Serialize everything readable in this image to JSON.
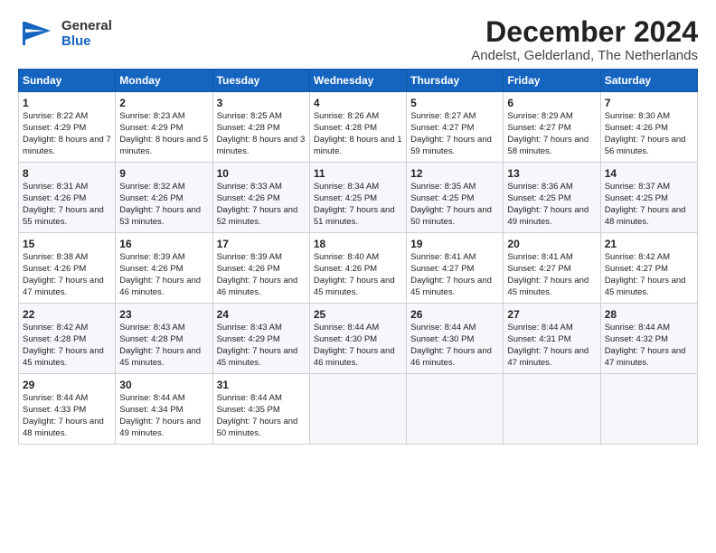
{
  "header": {
    "logo_general": "General",
    "logo_blue": "Blue",
    "title": "December 2024",
    "subtitle": "Andelst, Gelderland, The Netherlands"
  },
  "columns": [
    "Sunday",
    "Monday",
    "Tuesday",
    "Wednesday",
    "Thursday",
    "Friday",
    "Saturday"
  ],
  "weeks": [
    [
      {
        "day": "1",
        "sunrise": "Sunrise: 8:22 AM",
        "sunset": "Sunset: 4:29 PM",
        "daylight": "Daylight: 8 hours and 7 minutes."
      },
      {
        "day": "2",
        "sunrise": "Sunrise: 8:23 AM",
        "sunset": "Sunset: 4:29 PM",
        "daylight": "Daylight: 8 hours and 5 minutes."
      },
      {
        "day": "3",
        "sunrise": "Sunrise: 8:25 AM",
        "sunset": "Sunset: 4:28 PM",
        "daylight": "Daylight: 8 hours and 3 minutes."
      },
      {
        "day": "4",
        "sunrise": "Sunrise: 8:26 AM",
        "sunset": "Sunset: 4:28 PM",
        "daylight": "Daylight: 8 hours and 1 minute."
      },
      {
        "day": "5",
        "sunrise": "Sunrise: 8:27 AM",
        "sunset": "Sunset: 4:27 PM",
        "daylight": "Daylight: 7 hours and 59 minutes."
      },
      {
        "day": "6",
        "sunrise": "Sunrise: 8:29 AM",
        "sunset": "Sunset: 4:27 PM",
        "daylight": "Daylight: 7 hours and 58 minutes."
      },
      {
        "day": "7",
        "sunrise": "Sunrise: 8:30 AM",
        "sunset": "Sunset: 4:26 PM",
        "daylight": "Daylight: 7 hours and 56 minutes."
      }
    ],
    [
      {
        "day": "8",
        "sunrise": "Sunrise: 8:31 AM",
        "sunset": "Sunset: 4:26 PM",
        "daylight": "Daylight: 7 hours and 55 minutes."
      },
      {
        "day": "9",
        "sunrise": "Sunrise: 8:32 AM",
        "sunset": "Sunset: 4:26 PM",
        "daylight": "Daylight: 7 hours and 53 minutes."
      },
      {
        "day": "10",
        "sunrise": "Sunrise: 8:33 AM",
        "sunset": "Sunset: 4:26 PM",
        "daylight": "Daylight: 7 hours and 52 minutes."
      },
      {
        "day": "11",
        "sunrise": "Sunrise: 8:34 AM",
        "sunset": "Sunset: 4:25 PM",
        "daylight": "Daylight: 7 hours and 51 minutes."
      },
      {
        "day": "12",
        "sunrise": "Sunrise: 8:35 AM",
        "sunset": "Sunset: 4:25 PM",
        "daylight": "Daylight: 7 hours and 50 minutes."
      },
      {
        "day": "13",
        "sunrise": "Sunrise: 8:36 AM",
        "sunset": "Sunset: 4:25 PM",
        "daylight": "Daylight: 7 hours and 49 minutes."
      },
      {
        "day": "14",
        "sunrise": "Sunrise: 8:37 AM",
        "sunset": "Sunset: 4:25 PM",
        "daylight": "Daylight: 7 hours and 48 minutes."
      }
    ],
    [
      {
        "day": "15",
        "sunrise": "Sunrise: 8:38 AM",
        "sunset": "Sunset: 4:26 PM",
        "daylight": "Daylight: 7 hours and 47 minutes."
      },
      {
        "day": "16",
        "sunrise": "Sunrise: 8:39 AM",
        "sunset": "Sunset: 4:26 PM",
        "daylight": "Daylight: 7 hours and 46 minutes."
      },
      {
        "day": "17",
        "sunrise": "Sunrise: 8:39 AM",
        "sunset": "Sunset: 4:26 PM",
        "daylight": "Daylight: 7 hours and 46 minutes."
      },
      {
        "day": "18",
        "sunrise": "Sunrise: 8:40 AM",
        "sunset": "Sunset: 4:26 PM",
        "daylight": "Daylight: 7 hours and 45 minutes."
      },
      {
        "day": "19",
        "sunrise": "Sunrise: 8:41 AM",
        "sunset": "Sunset: 4:27 PM",
        "daylight": "Daylight: 7 hours and 45 minutes."
      },
      {
        "day": "20",
        "sunrise": "Sunrise: 8:41 AM",
        "sunset": "Sunset: 4:27 PM",
        "daylight": "Daylight: 7 hours and 45 minutes."
      },
      {
        "day": "21",
        "sunrise": "Sunrise: 8:42 AM",
        "sunset": "Sunset: 4:27 PM",
        "daylight": "Daylight: 7 hours and 45 minutes."
      }
    ],
    [
      {
        "day": "22",
        "sunrise": "Sunrise: 8:42 AM",
        "sunset": "Sunset: 4:28 PM",
        "daylight": "Daylight: 7 hours and 45 minutes."
      },
      {
        "day": "23",
        "sunrise": "Sunrise: 8:43 AM",
        "sunset": "Sunset: 4:28 PM",
        "daylight": "Daylight: 7 hours and 45 minutes."
      },
      {
        "day": "24",
        "sunrise": "Sunrise: 8:43 AM",
        "sunset": "Sunset: 4:29 PM",
        "daylight": "Daylight: 7 hours and 45 minutes."
      },
      {
        "day": "25",
        "sunrise": "Sunrise: 8:44 AM",
        "sunset": "Sunset: 4:30 PM",
        "daylight": "Daylight: 7 hours and 46 minutes."
      },
      {
        "day": "26",
        "sunrise": "Sunrise: 8:44 AM",
        "sunset": "Sunset: 4:30 PM",
        "daylight": "Daylight: 7 hours and 46 minutes."
      },
      {
        "day": "27",
        "sunrise": "Sunrise: 8:44 AM",
        "sunset": "Sunset: 4:31 PM",
        "daylight": "Daylight: 7 hours and 47 minutes."
      },
      {
        "day": "28",
        "sunrise": "Sunrise: 8:44 AM",
        "sunset": "Sunset: 4:32 PM",
        "daylight": "Daylight: 7 hours and 47 minutes."
      }
    ],
    [
      {
        "day": "29",
        "sunrise": "Sunrise: 8:44 AM",
        "sunset": "Sunset: 4:33 PM",
        "daylight": "Daylight: 7 hours and 48 minutes."
      },
      {
        "day": "30",
        "sunrise": "Sunrise: 8:44 AM",
        "sunset": "Sunset: 4:34 PM",
        "daylight": "Daylight: 7 hours and 49 minutes."
      },
      {
        "day": "31",
        "sunrise": "Sunrise: 8:44 AM",
        "sunset": "Sunset: 4:35 PM",
        "daylight": "Daylight: 7 hours and 50 minutes."
      },
      null,
      null,
      null,
      null
    ]
  ]
}
